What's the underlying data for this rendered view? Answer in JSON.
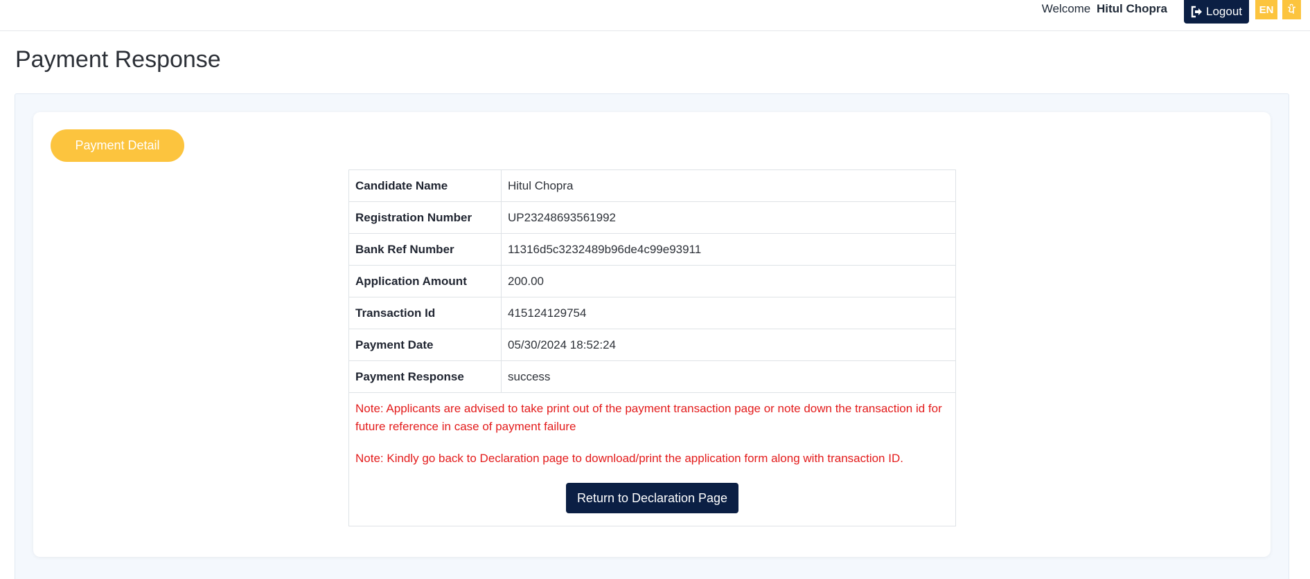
{
  "header": {
    "welcome_text": "Welcome",
    "user_name": "Hitul Chopra",
    "logout_label": "Logout",
    "lang_en": "EN",
    "lang_pa": "ਪੰ"
  },
  "page": {
    "title": "Payment Response"
  },
  "section": {
    "pill_label": "Payment Detail"
  },
  "details": [
    {
      "label": "Candidate Name",
      "value": "Hitul Chopra"
    },
    {
      "label": "Registration Number",
      "value": "UP23248693561992"
    },
    {
      "label": "Bank Ref Number",
      "value": "11316d5c3232489b96de4c99e93911"
    },
    {
      "label": "Application Amount",
      "value": "200.00"
    },
    {
      "label": "Transaction Id",
      "value": "415124129754"
    },
    {
      "label": "Payment Date",
      "value": "05/30/2024 18:52:24"
    },
    {
      "label": "Payment Response",
      "value": "success"
    }
  ],
  "notes": {
    "note1": "Note: Applicants are advised to take print out of the payment transaction page or note down the transaction id for future reference in case of payment failure",
    "note2": "Note: Kindly go back to Declaration page to download/print the application form along with transaction ID."
  },
  "actions": {
    "return_label": "Return to Declaration Page"
  },
  "colors": {
    "navy": "#0b1f44",
    "accent_yellow": "#fcc43e",
    "note_red": "#e31b1b"
  }
}
